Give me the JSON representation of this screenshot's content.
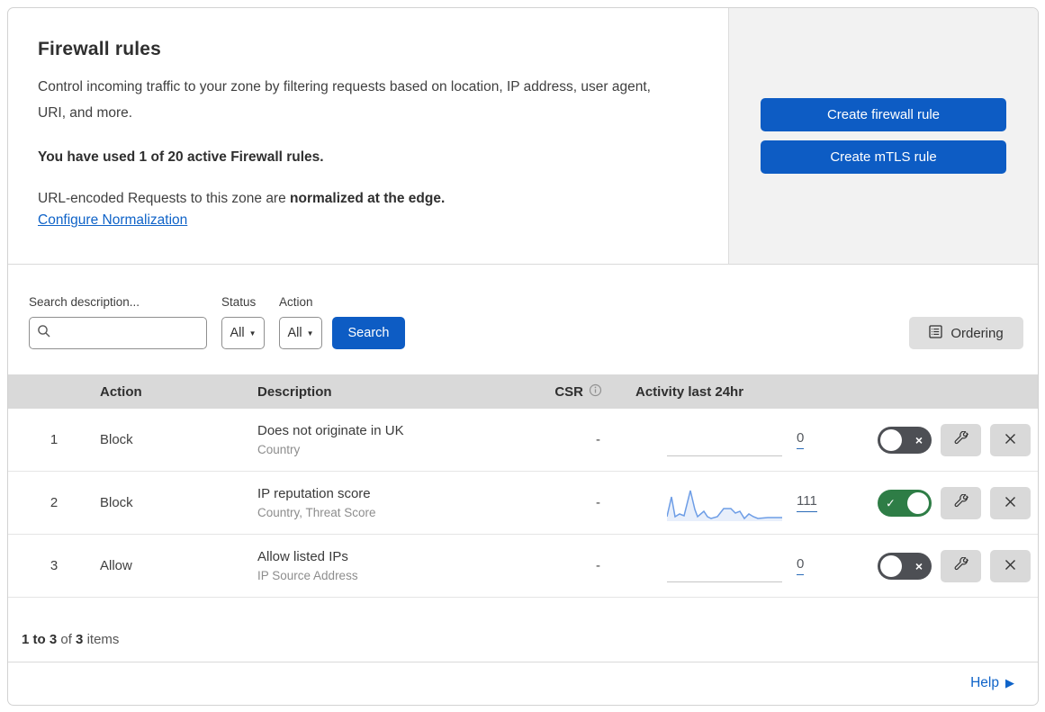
{
  "header": {
    "title": "Firewall rules",
    "description": "Control incoming traffic to your zone by filtering requests based on location, IP address, user agent, URI, and more.",
    "usage": "You have used 1 of 20 active Firewall rules.",
    "normalization_prefix": "URL-encoded Requests to this zone are ",
    "normalization_bold": "normalized at the edge.",
    "normalization_link": "Configure Normalization",
    "create_firewall_button": "Create firewall rule",
    "create_mtls_button": "Create mTLS rule"
  },
  "filters": {
    "search_label": "Search description...",
    "search_value": "",
    "status_label": "Status",
    "status_value": "All",
    "action_label": "Action",
    "action_value": "All",
    "search_button": "Search",
    "ordering_button": "Ordering"
  },
  "table": {
    "columns": {
      "action": "Action",
      "description": "Description",
      "csr": "CSR",
      "activity": "Activity last 24hr"
    },
    "rows": [
      {
        "num": "1",
        "action": "Block",
        "title": "Does not originate in UK",
        "subtitle": "Country",
        "csr": "-",
        "count": "0",
        "enabled": false,
        "sparkline": null
      },
      {
        "num": "2",
        "action": "Block",
        "title": "IP reputation score",
        "subtitle": "Country, Threat Score",
        "csr": "-",
        "count": "111",
        "enabled": true,
        "sparkline": [
          [
            0,
            36
          ],
          [
            5,
            14
          ],
          [
            9,
            36
          ],
          [
            14,
            33
          ],
          [
            19,
            35
          ],
          [
            26,
            7
          ],
          [
            31,
            28
          ],
          [
            34,
            36
          ],
          [
            41,
            30
          ],
          [
            45,
            36
          ],
          [
            49,
            38
          ],
          [
            56,
            36
          ],
          [
            63,
            27
          ],
          [
            71,
            27
          ],
          [
            76,
            32
          ],
          [
            81,
            30
          ],
          [
            86,
            38
          ],
          [
            91,
            33
          ],
          [
            96,
            36
          ],
          [
            101,
            38
          ],
          [
            112,
            37
          ],
          [
            128,
            37
          ]
        ]
      },
      {
        "num": "3",
        "action": "Allow",
        "title": "Allow listed IPs",
        "subtitle": "IP Source Address",
        "csr": "-",
        "count": "0",
        "enabled": false,
        "sparkline": null
      }
    ],
    "footer": {
      "range": "1 to 3",
      "of": "of",
      "total": "3",
      "items": "items"
    }
  },
  "help": {
    "label": "Help"
  },
  "colors": {
    "accent_blue": "#0d5cc4",
    "link_blue": "#0f63c8",
    "toggle_on_green": "#2e7d46",
    "toggle_off_gray": "#4d4f54",
    "sparkline_blue": "#6d9de6",
    "table_header_gray": "#d9d9d9",
    "panel_gray": "#f2f2f2"
  }
}
